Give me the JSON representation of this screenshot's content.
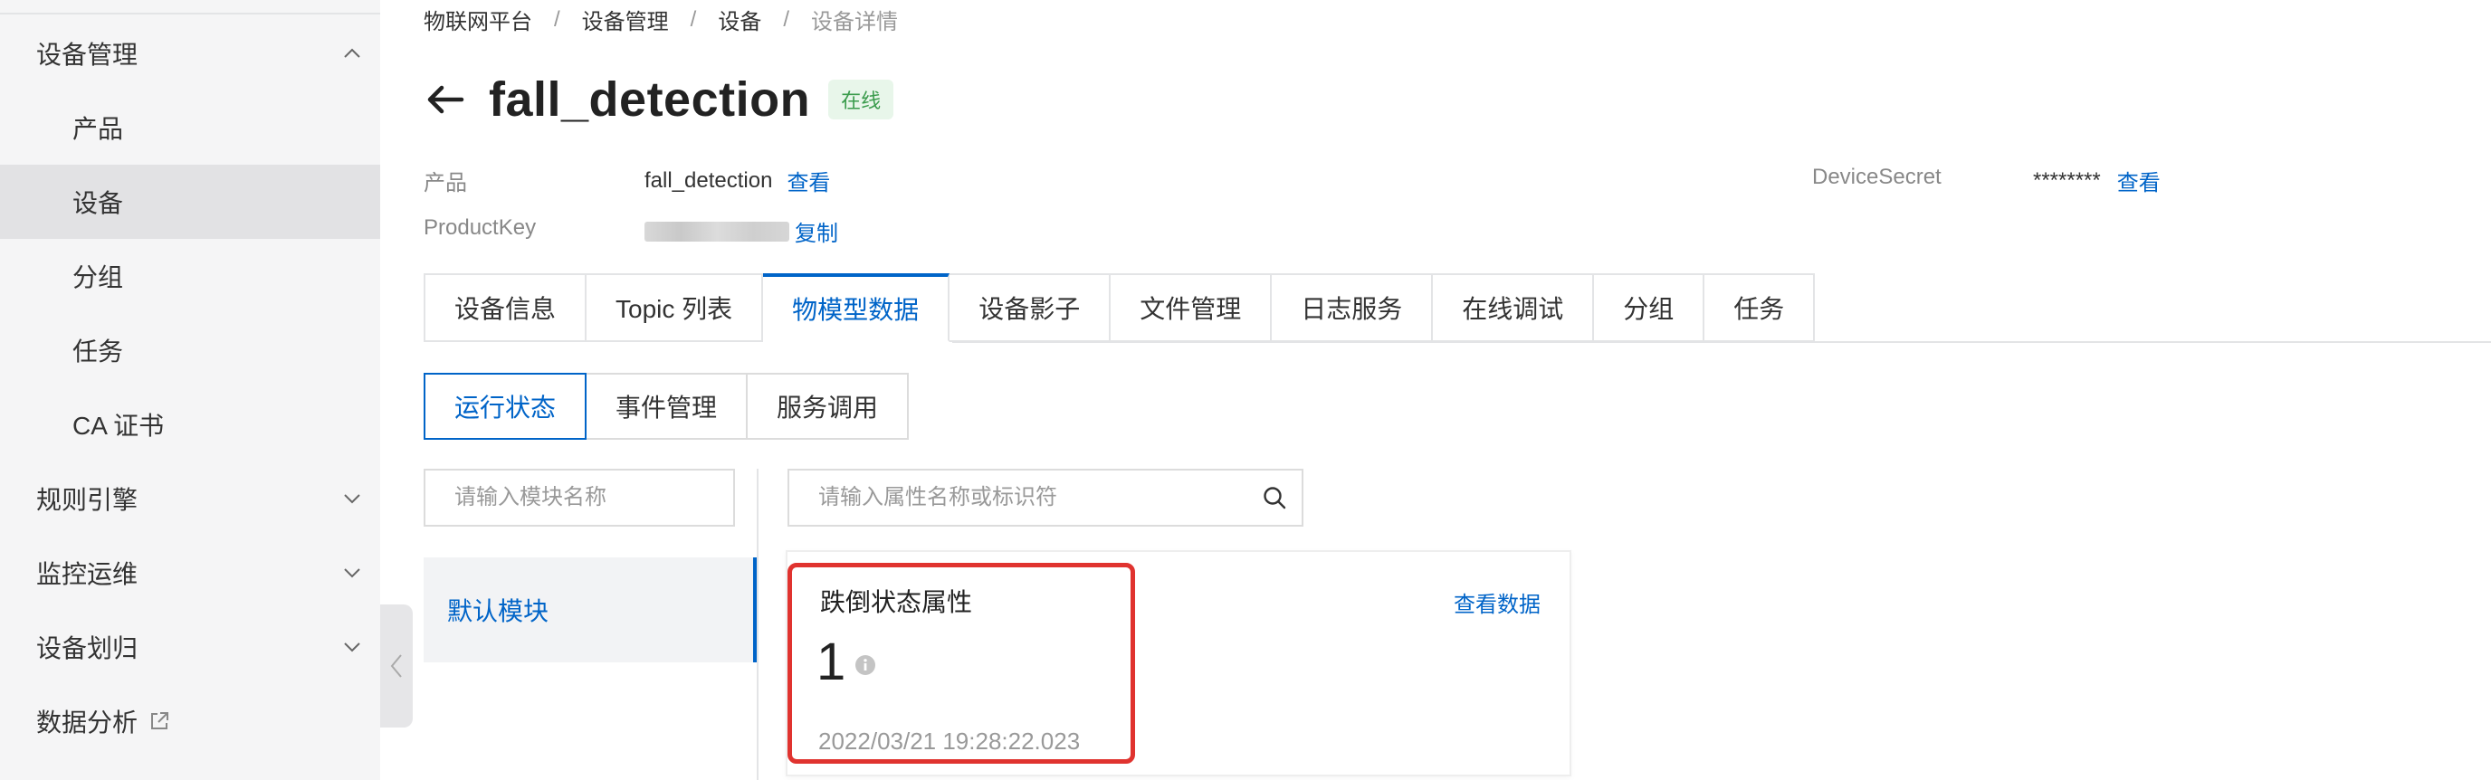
{
  "sidebar": {
    "items": [
      {
        "label": "设备管理",
        "type": "group",
        "expanded": true
      },
      {
        "label": "产品",
        "type": "sub"
      },
      {
        "label": "设备",
        "type": "sub",
        "active": true
      },
      {
        "label": "分组",
        "type": "sub"
      },
      {
        "label": "任务",
        "type": "sub"
      },
      {
        "label": "CA 证书",
        "type": "sub"
      },
      {
        "label": "规则引擎",
        "type": "group",
        "expanded": false
      },
      {
        "label": "监控运维",
        "type": "group",
        "expanded": false
      },
      {
        "label": "设备划归",
        "type": "group",
        "expanded": false
      },
      {
        "label": "数据分析",
        "type": "group",
        "external": true
      }
    ]
  },
  "breadcrumb": {
    "items": [
      "物联网平台",
      "设备管理",
      "设备"
    ],
    "current": "设备详情",
    "separator": "/"
  },
  "header": {
    "title": "fall_detection",
    "status": "在线"
  },
  "meta": {
    "product_label": "产品",
    "product_value": "fall_detection",
    "product_link": "查看",
    "productkey_label": "ProductKey",
    "productkey_link": "复制",
    "secret_label": "DeviceSecret",
    "secret_value": "********",
    "secret_link": "查看"
  },
  "tabs": [
    {
      "label": "设备信息"
    },
    {
      "label": "Topic 列表"
    },
    {
      "label": "物模型数据",
      "active": true
    },
    {
      "label": "设备影子"
    },
    {
      "label": "文件管理"
    },
    {
      "label": "日志服务"
    },
    {
      "label": "在线调试"
    },
    {
      "label": "分组"
    },
    {
      "label": "任务"
    }
  ],
  "subtabs": [
    {
      "label": "运行状态",
      "active": true
    },
    {
      "label": "事件管理"
    },
    {
      "label": "服务调用"
    }
  ],
  "module_search": {
    "placeholder": "请输入模块名称",
    "value": ""
  },
  "property_search": {
    "placeholder": "请输入属性名称或标识符",
    "value": ""
  },
  "modules": [
    {
      "label": "默认模块",
      "active": true
    }
  ],
  "property_card": {
    "title": "跌倒状态属性",
    "link": "查看数据",
    "value": "1",
    "timestamp": "2022/03/21 19:28:22.023"
  },
  "colors": {
    "accent": "#0064c8",
    "status_green": "#3a9b4c",
    "highlight_red": "#e0332f"
  }
}
